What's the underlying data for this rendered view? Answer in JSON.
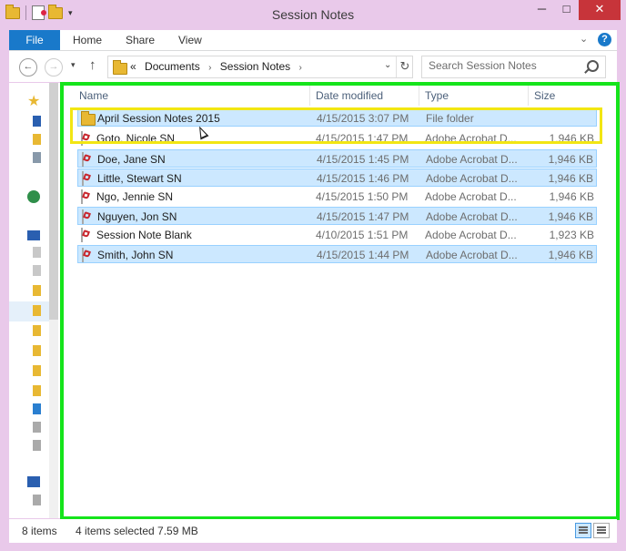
{
  "window": {
    "title": "Session Notes",
    "min_label": "─",
    "max_label": "□",
    "close_label": "✕"
  },
  "ribbon": {
    "tabs": [
      "File",
      "Home",
      "Share",
      "View"
    ],
    "help": "?",
    "collapse": "⌄"
  },
  "nav": {
    "back": "←",
    "forward": "→",
    "recent": "▾",
    "up": "↑",
    "breadcrumb": [
      "Documents",
      "Session Notes"
    ],
    "overflow": "«",
    "separator": "›",
    "dropdown": "⌄",
    "refresh": "↻"
  },
  "search": {
    "placeholder": "Search Session Notes"
  },
  "columns": [
    "Name",
    "Date modified",
    "Type",
    "Size"
  ],
  "files": [
    {
      "name": "April Session Notes 2015",
      "date": "4/15/2015 3:07 PM",
      "type": "File folder",
      "size": "",
      "kind": "folder",
      "selected": true
    },
    {
      "name": "Goto, Nicole SN",
      "date": "4/15/2015 1:47 PM",
      "type": "Adobe Acrobat D...",
      "size": "1,946 KB",
      "kind": "pdf",
      "selected": false
    },
    {
      "name": "Doe, Jane SN",
      "date": "4/15/2015 1:45 PM",
      "type": "Adobe Acrobat D...",
      "size": "1,946 KB",
      "kind": "pdf",
      "selected": true
    },
    {
      "name": "Little, Stewart SN",
      "date": "4/15/2015 1:46 PM",
      "type": "Adobe Acrobat D...",
      "size": "1,946 KB",
      "kind": "pdf",
      "selected": true
    },
    {
      "name": "Ngo, Jennie SN",
      "date": "4/15/2015 1:50 PM",
      "type": "Adobe Acrobat D...",
      "size": "1,946 KB",
      "kind": "pdf",
      "selected": false
    },
    {
      "name": "Nguyen, Jon SN",
      "date": "4/15/2015 1:47 PM",
      "type": "Adobe Acrobat D...",
      "size": "1,946 KB",
      "kind": "pdf",
      "selected": true
    },
    {
      "name": "Session Note Blank",
      "date": "4/10/2015 1:51 PM",
      "type": "Adobe Acrobat D...",
      "size": "1,923 KB",
      "kind": "pdf",
      "selected": false
    },
    {
      "name": "Smith, John SN",
      "date": "4/15/2015 1:44 PM",
      "type": "Adobe Acrobat D...",
      "size": "1,946 KB",
      "kind": "pdf",
      "selected": true
    }
  ],
  "status": {
    "items": "8 items",
    "selected": "4 items selected  7.59 MB"
  },
  "colors": {
    "accent": "#1979ca",
    "selection": "#cce8ff",
    "highlight_green": "#15e41b",
    "highlight_yellow": "#f2e613",
    "close": "#c7343a"
  }
}
